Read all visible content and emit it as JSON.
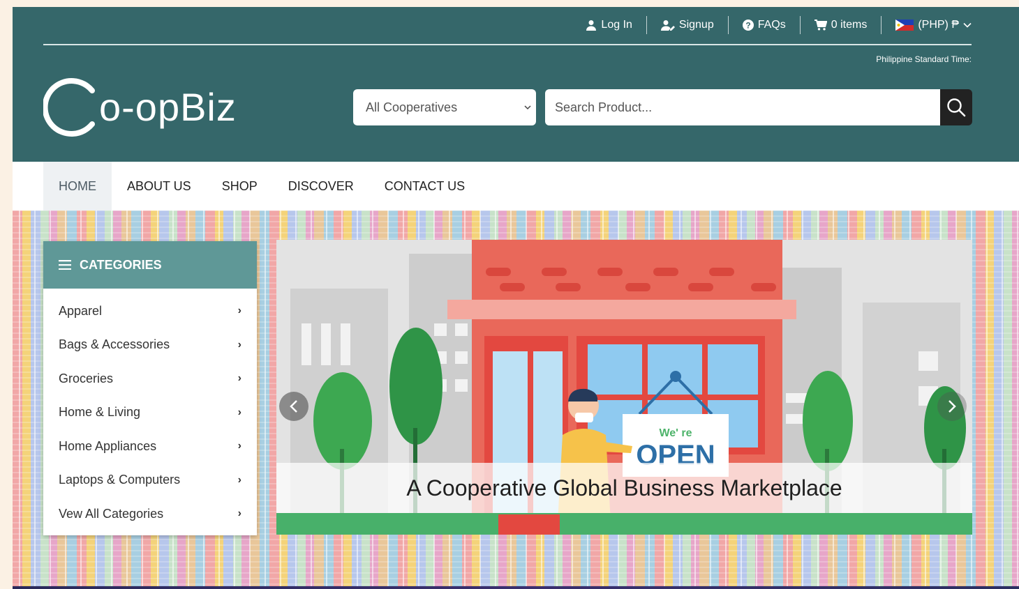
{
  "topbar": {
    "login": "Log In",
    "signup": "Signup",
    "faqs": "FAQs",
    "cart": "0 items",
    "currency": "(PHP) ₱"
  },
  "header": {
    "timezone_label": "Philippine Standard Time:",
    "logo_text": "o-opBiz",
    "cooperative_select": "All Cooperatives",
    "search_placeholder": "Search Product..."
  },
  "nav": {
    "items": [
      "HOME",
      "ABOUT US",
      "SHOP",
      "DISCOVER",
      "CONTACT US"
    ],
    "active": "HOME"
  },
  "categories": {
    "title": "CATEGORIES",
    "items": [
      "Apparel",
      "Bags & Accessories",
      "Groceries",
      "Home & Living",
      "Home Appliances",
      "Laptops & Computers",
      "Vew All Categories"
    ]
  },
  "slider": {
    "caption": "A Cooperative Global Business Marketplace",
    "sign_top": "We' re",
    "sign_main": "OPEN"
  },
  "colors": {
    "header_bg": "#35676a",
    "category_header": "#5f9897",
    "shop_red": "#e9685a"
  }
}
